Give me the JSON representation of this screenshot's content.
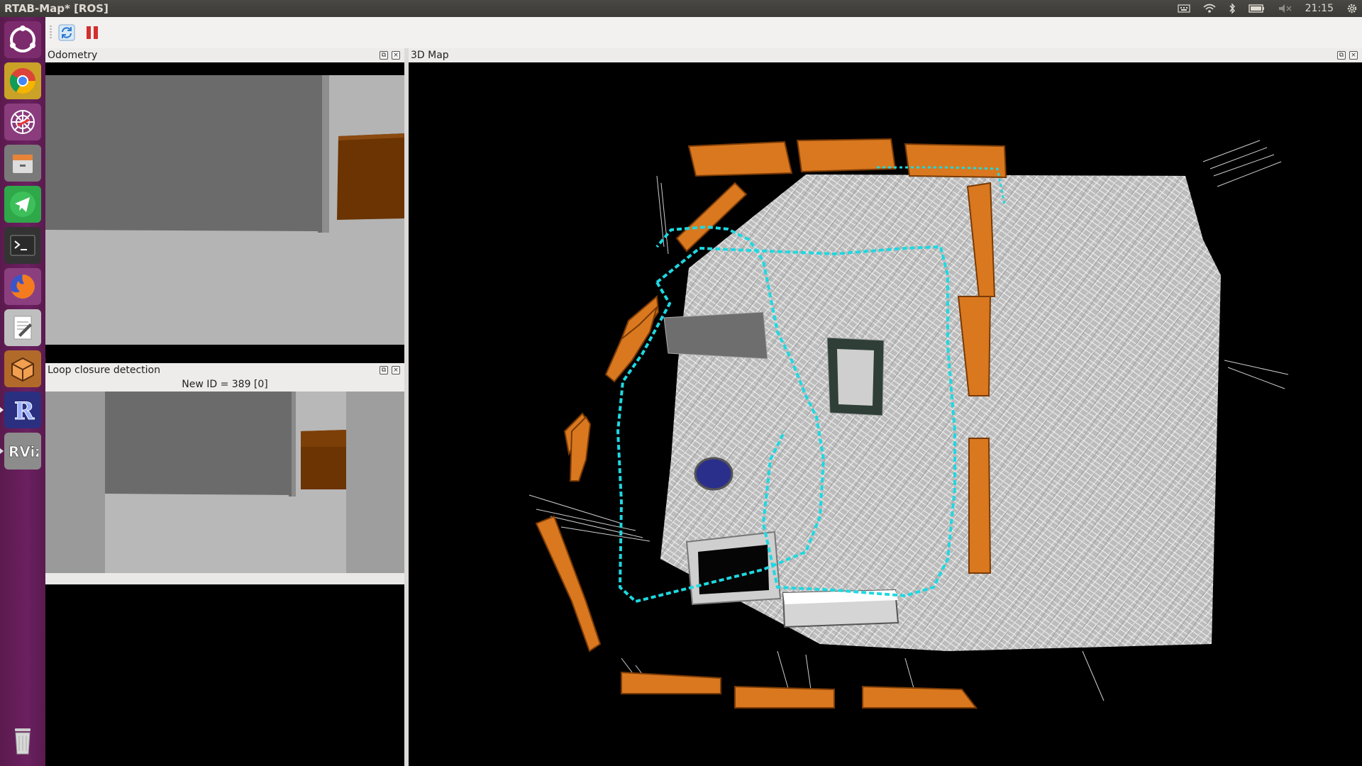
{
  "window": {
    "title": "RTAB-Map* [ROS]"
  },
  "tray": {
    "clock": "21:15"
  },
  "launcher": {
    "items": [
      {
        "name": "ubuntu-dash-icon"
      },
      {
        "name": "chrome-icon"
      },
      {
        "name": "spider-app-icon"
      },
      {
        "name": "files-icon"
      },
      {
        "name": "telegram-icon"
      },
      {
        "name": "terminal-icon"
      },
      {
        "name": "firefox-icon"
      },
      {
        "name": "text-editor-icon"
      },
      {
        "name": "box-app-icon"
      },
      {
        "name": "rtabmap-icon"
      },
      {
        "name": "rviz-icon"
      },
      {
        "name": "trash-icon"
      }
    ]
  },
  "toolbar": {
    "buttons": [
      {
        "name": "refresh-icon",
        "color": "#2f7fd0"
      },
      {
        "name": "pause-icon",
        "color": "#d32f2f"
      }
    ]
  },
  "docks": {
    "odometry": {
      "title": "Odometry"
    },
    "loop_closure": {
      "title": "Loop closure detection",
      "status": "New ID = 389 [0]"
    },
    "map3d": {
      "title": "3D Map"
    }
  },
  "colors": {
    "walls": "#d9781f",
    "trajectory": "#1fd8e0",
    "floor_points": "#e0e0e0",
    "background": "#000000"
  }
}
